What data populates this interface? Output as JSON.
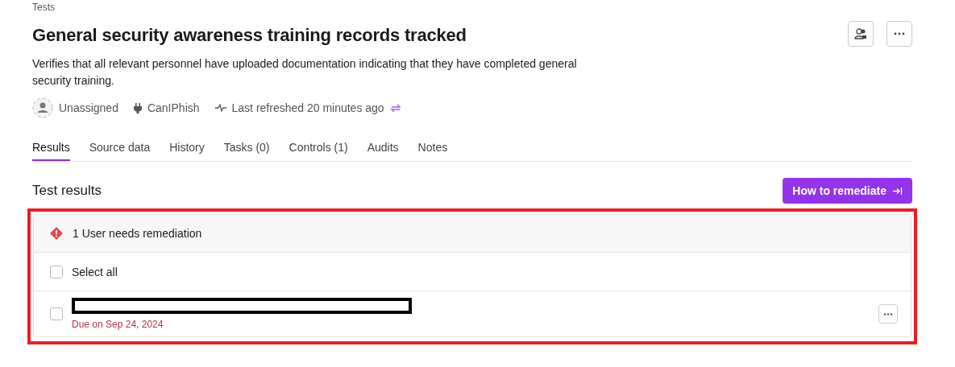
{
  "breadcrumb": "Tests",
  "title": "General security awareness training records tracked",
  "description": "Verifies that all relevant personnel have uploaded documentation indicating that they have completed general security training.",
  "meta": {
    "owner": "Unassigned",
    "integration": "CanIPhish",
    "refreshed": "Last refreshed 20 minutes ago"
  },
  "tabs": [
    {
      "label": "Results",
      "selected": true
    },
    {
      "label": "Source data",
      "selected": false
    },
    {
      "label": "History",
      "selected": false
    },
    {
      "label": "Tasks (0)",
      "selected": false
    },
    {
      "label": "Controls (1)",
      "selected": false
    },
    {
      "label": "Audits",
      "selected": false
    },
    {
      "label": "Notes",
      "selected": false
    }
  ],
  "section_title": "Test results",
  "remediate_button": "How to remediate",
  "results": {
    "summary": "1 User needs remediation",
    "select_all": {
      "label": "Select all",
      "checked": false
    },
    "rows": [
      {
        "checked": false,
        "due": "Due on Sep 24, 2024"
      }
    ]
  }
}
